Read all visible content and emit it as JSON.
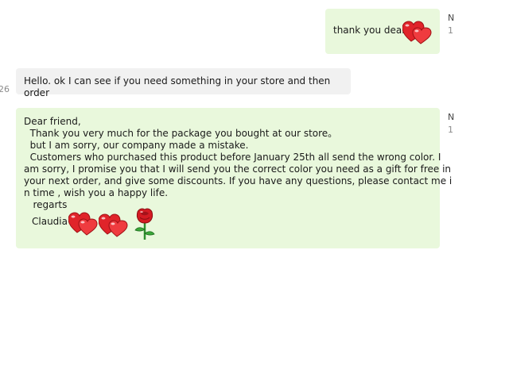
{
  "messages": [
    {
      "side": "sent",
      "text": "thank you dear",
      "emoji": "double-heart-icon",
      "edge_label_top": "N",
      "edge_label_bottom": "1"
    },
    {
      "side": "received",
      "text": "Hello. ok I can see if you need something in your store and then order",
      "edge_label": "26"
    },
    {
      "side": "sent",
      "lines": [
        "Dear friend,",
        "  Thank you very much for the package you bought at our store。",
        "  but I am sorry, our company made a mistake.",
        "  Customers who purchased this product before January 25th all send the wrong color. I",
        "am sorry, I promise you that I will send you the correct color you need as a gift for free in",
        "your next order, and give some discounts. If you have any questions, please contact me i",
        "n time , wish you a happy life.",
        "   regarts"
      ],
      "signature": "Claudia",
      "emojis": [
        "double-heart-icon",
        "double-heart-icon",
        "rose-icon"
      ],
      "edge_label_top": "N",
      "edge_label_bottom": "1"
    }
  ],
  "colors": {
    "sent_bubble": "#e9f8dc",
    "received_bubble": "#f1f1f1",
    "heart": "#e0242a",
    "rose": "#d41b23",
    "stem": "#2f8f2f"
  }
}
